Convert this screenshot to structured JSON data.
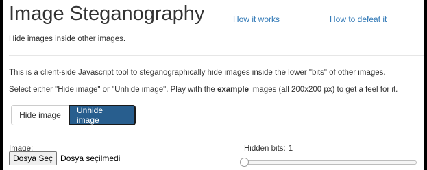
{
  "header": {
    "title": "Image Steganography",
    "nav": {
      "how_it_works": "How it works",
      "how_to_defeat": "How to defeat it"
    },
    "subtitle": "Hide images inside other images."
  },
  "main": {
    "intro": "This is a client-side Javascript tool to steganographically hide images inside the lower \"bits\" of other images.",
    "instructions_before": "Select either \"Hide image\" or \"Unhide image\". Play with the ",
    "instructions_bold": "example",
    "instructions_after": " images (all 200x200 px) to get a feel for it.",
    "mode_buttons": {
      "hide": "Hide image",
      "unhide": "Unhide image",
      "active": "unhide"
    },
    "image_field": {
      "label": "Image:",
      "button": "Dosya Seç",
      "status": "Dosya seçilmedi"
    },
    "hidden_bits": {
      "label": "Hidden bits:",
      "value": "1",
      "slider_value": 1,
      "slider_min": 1,
      "slider_max": 8
    }
  },
  "colors": {
    "link": "#337ab7",
    "active_button": "#285e8e",
    "text": "#333333"
  }
}
